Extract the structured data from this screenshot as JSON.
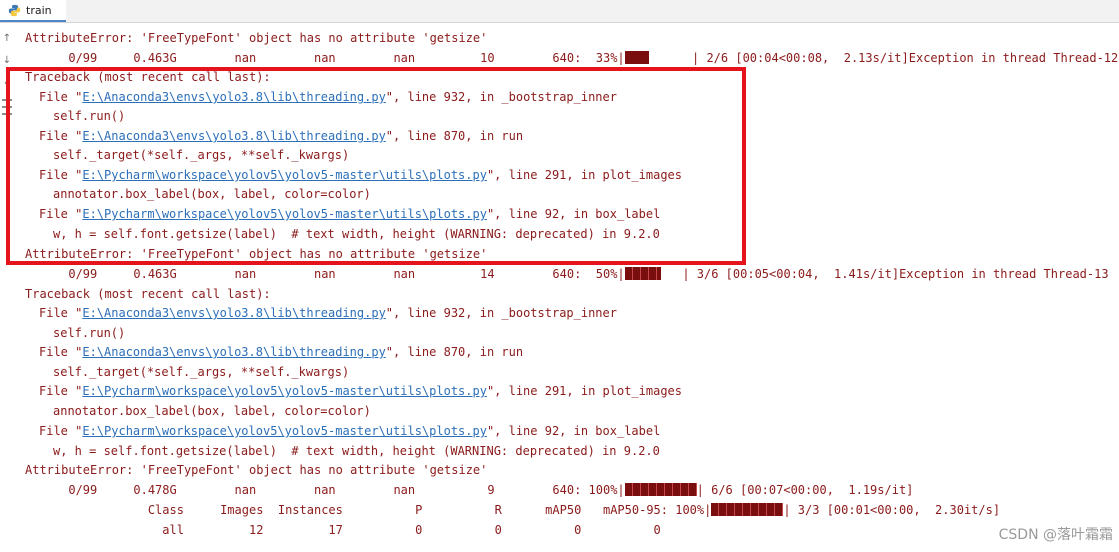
{
  "tab": {
    "label": "train"
  },
  "lines": {
    "l1": "AttributeError: 'FreeTypeFont' object has no attribute 'getsize'",
    "l2_pre": "      0/99     0.463G        nan        nan        nan         10        640:  33%|",
    "l2_post": "      | 2/6 [00:04<00:08,  2.13s/it]Exception in thread Thread-12",
    "tb1": {
      "l3": "Traceback (most recent call last):",
      "l4_a": "File \"",
      "l4_link": "E:\\Anaconda3\\envs\\yolo3.8\\lib\\threading.py",
      "l4_b": "\", line 932, in _bootstrap_inner",
      "l5": "self.run()",
      "l6_a": "File \"",
      "l6_link": "E:\\Anaconda3\\envs\\yolo3.8\\lib\\threading.py",
      "l6_b": "\", line 870, in run",
      "l7": "self._target(*self._args, **self._kwargs)",
      "l8_a": "File \"",
      "l8_link": "E:\\Pycharm\\workspace\\yolov5\\yolov5-master\\utils\\plots.py",
      "l8_b": "\", line 291, in plot_images",
      "l9": "annotator.box_label(box, label, color=color)",
      "l10_a": "File \"",
      "l10_link": "E:\\Pycharm\\workspace\\yolov5\\yolov5-master\\utils\\plots.py",
      "l10_b": "\", line 92, in box_label",
      "l11": "w, h = self.font.getsize(label)  # text width, height (WARNING: deprecated) in 9.2.0",
      "l12": "AttributeError: 'FreeTypeFont' object has no attribute 'getsize'"
    },
    "l13_pre": "      0/99     0.463G        nan        nan        nan         14        640:  50%|",
    "l13_post": "   | 3/6 [00:05<00:04,  1.41s/it]Exception in thread Thread-13",
    "tb2": {
      "l14": "Traceback (most recent call last):",
      "l15_a": "File \"",
      "l15_link": "E:\\Anaconda3\\envs\\yolo3.8\\lib\\threading.py",
      "l15_b": "\", line 932, in _bootstrap_inner",
      "l16": "self.run()",
      "l17_a": "File \"",
      "l17_link": "E:\\Anaconda3\\envs\\yolo3.8\\lib\\threading.py",
      "l17_b": "\", line 870, in run",
      "l18": "self._target(*self._args, **self._kwargs)",
      "l19_a": "File \"",
      "l19_link": "E:\\Pycharm\\workspace\\yolov5\\yolov5-master\\utils\\plots.py",
      "l19_b": "\", line 291, in plot_images",
      "l20": "annotator.box_label(box, label, color=color)",
      "l21_a": "File \"",
      "l21_link": "E:\\Pycharm\\workspace\\yolov5\\yolov5-master\\utils\\plots.py",
      "l21_b": "\", line 92, in box_label",
      "l22": "w, h = self.font.getsize(label)  # text width, height (WARNING: deprecated) in 9.2.0",
      "l23": "AttributeError: 'FreeTypeFont' object has no attribute 'getsize'"
    },
    "l24_pre": "      0/99     0.478G        nan        nan        nan          9        640: 100%|",
    "l24_post": "| 6/6 [00:07<00:00,  1.19s/it]",
    "l25_pre": "                 Class     Images  Instances          P          R      mAP50   mAP50-95: 100%|",
    "l25_post": "| 3/3 [00:01<00:00,  2.30it/s]",
    "l26": "                   all         12         17          0          0          0          0"
  },
  "progress": {
    "epoch0_a": 33,
    "epoch0_b": 50,
    "epoch0_c": 100,
    "val": 100
  },
  "watermark": "CSDN @落叶霜霜",
  "colors": {
    "error_text": "#8b1a1a",
    "link": "#2c6fb9",
    "highlight": "#e5141c",
    "progress_fill": "#7a0d0d"
  }
}
